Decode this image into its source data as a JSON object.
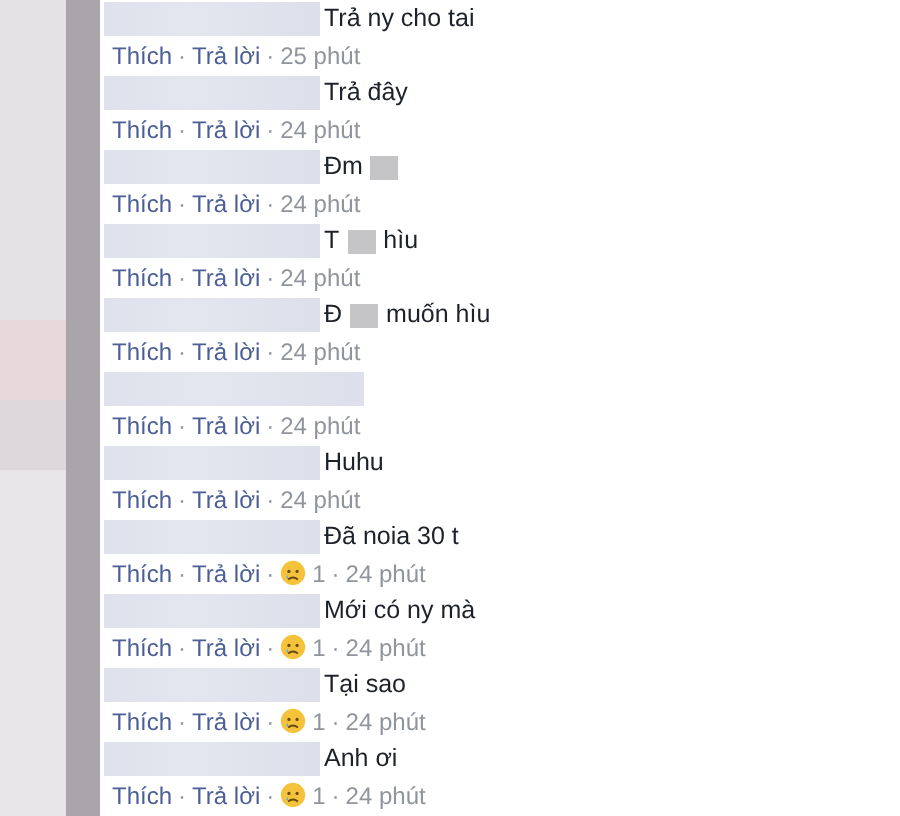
{
  "comments": [
    {
      "kind": "text",
      "segments": [
        {
          "kind": "text",
          "text": "Trả ny cho tai"
        }
      ],
      "like": "Thích",
      "reply": "Trả lời",
      "separators": [
        "·",
        "·"
      ],
      "time": "25 phút"
    },
    {
      "kind": "text",
      "segments": [
        {
          "kind": "text",
          "text": "Trả đây"
        }
      ],
      "like": "Thích",
      "reply": "Trả lời",
      "separators": [
        "·",
        "·"
      ],
      "time": "24 phút"
    },
    {
      "kind": "text",
      "segments": [
        {
          "kind": "text",
          "text": "Đm"
        },
        {
          "kind": "censor"
        }
      ],
      "like": "Thích",
      "reply": "Trả lời",
      "separators": [
        "·",
        "·"
      ],
      "time": "24 phút"
    },
    {
      "kind": "text",
      "segments": [
        {
          "kind": "text",
          "text": "T"
        },
        {
          "kind": "censor"
        },
        {
          "kind": "text",
          "text": "hìu"
        }
      ],
      "like": "Thích",
      "reply": "Trả lời",
      "separators": [
        "·",
        "·"
      ],
      "time": "24 phút"
    },
    {
      "kind": "text",
      "segments": [
        {
          "kind": "text",
          "text": "Đ"
        },
        {
          "kind": "censor"
        },
        {
          "kind": "text",
          "text": "muốn hìu"
        }
      ],
      "like": "Thích",
      "reply": "Trả lời",
      "separators": [
        "·",
        "·"
      ],
      "time": "24 phút"
    },
    {
      "kind": "blank",
      "like": "Thích",
      "reply": "Trả lời",
      "separators": [
        "·",
        "·"
      ],
      "time": "24 phút"
    },
    {
      "kind": "text",
      "segments": [
        {
          "kind": "text",
          "text": "Huhu"
        }
      ],
      "like": "Thích",
      "reply": "Trả lời",
      "separators": [
        "·",
        "·"
      ],
      "time": "24 phút"
    },
    {
      "kind": "text",
      "segments": [
        {
          "kind": "text",
          "text": "Đã noia 30 t"
        }
      ],
      "like": "Thích",
      "reply": "Trả lời",
      "separators": [
        "·",
        "·",
        "·"
      ],
      "reaction_count": "1",
      "time": "24 phút"
    },
    {
      "kind": "text",
      "segments": [
        {
          "kind": "text",
          "text": "Mới có ny mà"
        }
      ],
      "like": "Thích",
      "reply": "Trả lời",
      "separators": [
        "·",
        "·",
        "·"
      ],
      "reaction_count": "1",
      "time": "24 phút"
    },
    {
      "kind": "text",
      "segments": [
        {
          "kind": "text",
          "text": "Tại sao"
        }
      ],
      "like": "Thích",
      "reply": "Trả lời",
      "separators": [
        "·",
        "·",
        "·"
      ],
      "reaction_count": "1",
      "time": "24 phút"
    },
    {
      "kind": "text",
      "segments": [
        {
          "kind": "text",
          "text": "Anh ơi"
        }
      ],
      "like": "Thích",
      "reply": "Trả lời",
      "separators": [
        "·",
        "·",
        "·"
      ],
      "reaction_count": "1",
      "time": "24 phút"
    }
  ]
}
